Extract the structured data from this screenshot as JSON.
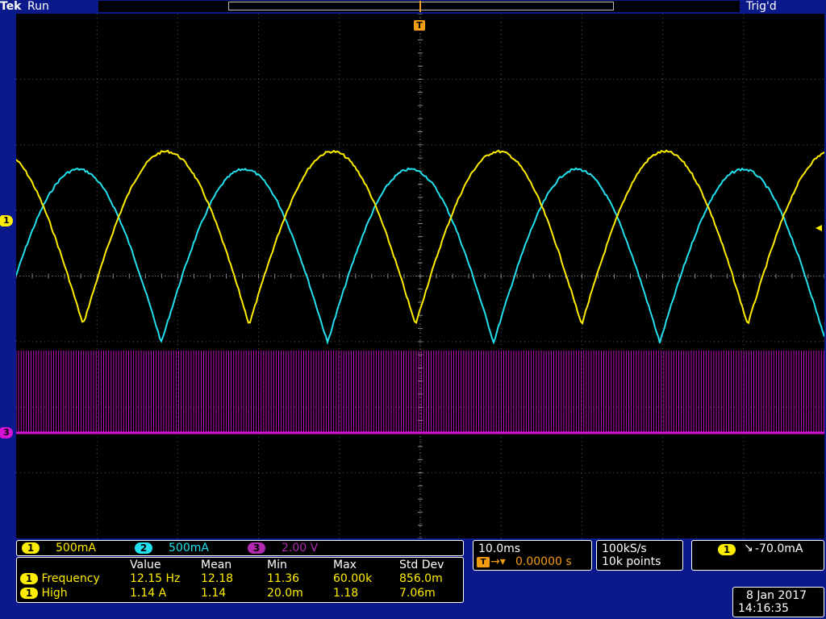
{
  "topbar": {
    "brand": "Tek",
    "run_state": "Run",
    "trig_state": "Trig'd"
  },
  "colors": {
    "ch1": "#ffee00",
    "ch2": "#22e0ee",
    "ch3": "#d512d5",
    "ch3_text": "#b02ab0"
  },
  "markers": {
    "trigger": "T",
    "ch1": "1",
    "ch3": "3"
  },
  "channels": [
    {
      "badge": "1",
      "scale": "500mA"
    },
    {
      "badge": "2",
      "scale": "500mA"
    },
    {
      "badge": "3",
      "scale": "2.00 V"
    }
  ],
  "timebase": {
    "scale": "10.0ms",
    "position": "0.00000 s"
  },
  "acquisition": {
    "sample_rate": "100kS/s",
    "record_length": "10k points"
  },
  "trigger": {
    "channel": "1",
    "level": "-70.0mA"
  },
  "measurements": {
    "headers": [
      "Value",
      "Mean",
      "Min",
      "Max",
      "Std Dev"
    ],
    "rows": [
      {
        "badge": "1",
        "name": "Frequency",
        "value": "12.15 Hz",
        "mean": "12.18",
        "min": "11.36",
        "max": "60.00k",
        "std": "856.0m"
      },
      {
        "badge": "1",
        "name": "High",
        "value": "1.14 A",
        "mean": "1.14",
        "min": "20.0m",
        "max": "1.18",
        "std": "7.06m"
      }
    ]
  },
  "datetime": {
    "date": "8 Jan  2017",
    "time": "14:16:35"
  }
}
